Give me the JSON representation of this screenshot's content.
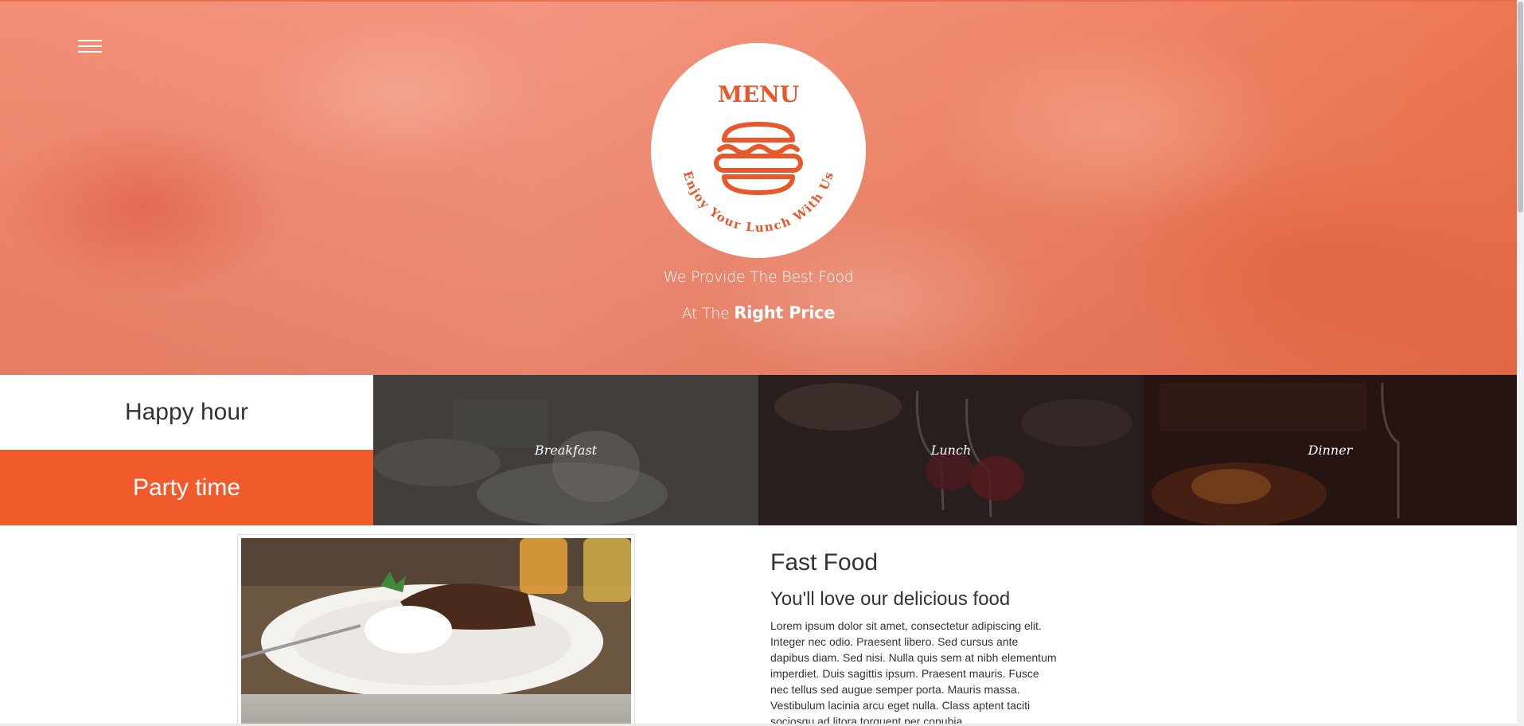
{
  "hero": {
    "menu_icon": "hamburger-icon",
    "logo": {
      "title": "MENU",
      "arc_text": "Enjoy Your Lunch With Us",
      "icon": "burger-icon"
    },
    "tagline_line1": "We Provide The Best Food",
    "tagline_line2_prefix": "At The",
    "tagline_line2_bold": "Right Price"
  },
  "categories": {
    "happy_hour": "Happy hour",
    "party_time": "Party time",
    "tiles": [
      {
        "label": "Breakfast"
      },
      {
        "label": "Lunch"
      },
      {
        "label": "Dinner"
      }
    ]
  },
  "article": {
    "title": "Fast Food",
    "subtitle": "You'll love our delicious food",
    "body": "Lorem ipsum dolor sit amet, consectetur adipiscing elit. Integer nec odio. Praesent libero. Sed cursus ante dapibus diam. Sed nisi. Nulla quis sem at nibh elementum imperdiet. Duis sagittis ipsum. Praesent mauris. Fusce nec tellus sed augue semper porta. Mauris massa. Vestibulum lacinia arcu eget nulla. Class aptent taciti sociosqu ad litora torquent per conubia"
  },
  "colors": {
    "accent": "#f15a2b",
    "logo_orange": "#e8582a",
    "hero_base": "#f2876d"
  }
}
